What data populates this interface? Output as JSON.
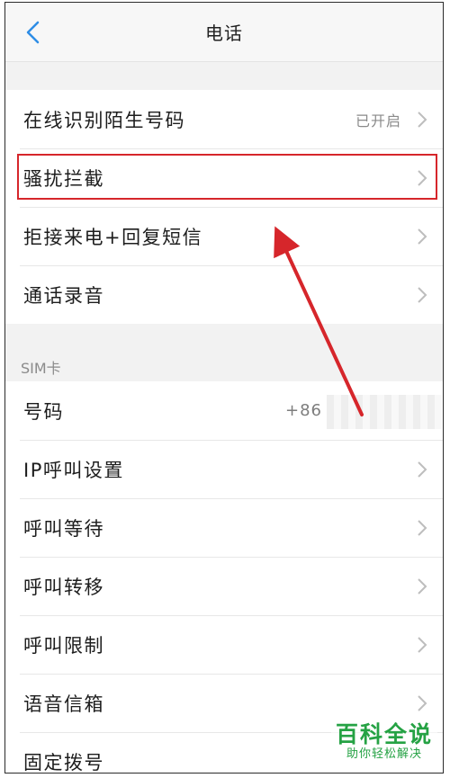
{
  "header": {
    "title": "电话",
    "back_icon": "chevron-left-icon"
  },
  "settings_group_1": [
    {
      "label": "在线识别陌生号码",
      "value": "已开启"
    },
    {
      "label": "骚扰拦截",
      "value": ""
    },
    {
      "label": "拒接来电+回复短信",
      "value": ""
    },
    {
      "label": "通话录音",
      "value": ""
    }
  ],
  "sim_section": {
    "title": "SIM卡",
    "items": [
      {
        "label": "号码",
        "value": "+86"
      },
      {
        "label": "IP呼叫设置",
        "value": ""
      },
      {
        "label": "呼叫等待",
        "value": ""
      },
      {
        "label": "呼叫转移",
        "value": ""
      },
      {
        "label": "呼叫限制",
        "value": ""
      },
      {
        "label": "语音信箱",
        "value": ""
      },
      {
        "label": "固定拨号",
        "value": ""
      }
    ]
  },
  "watermark": {
    "main": "百科全说",
    "sub": "助你轻松解决"
  },
  "colors": {
    "accent": "#2e8de6",
    "highlight": "#d6262b",
    "watermark": "#25a244"
  }
}
